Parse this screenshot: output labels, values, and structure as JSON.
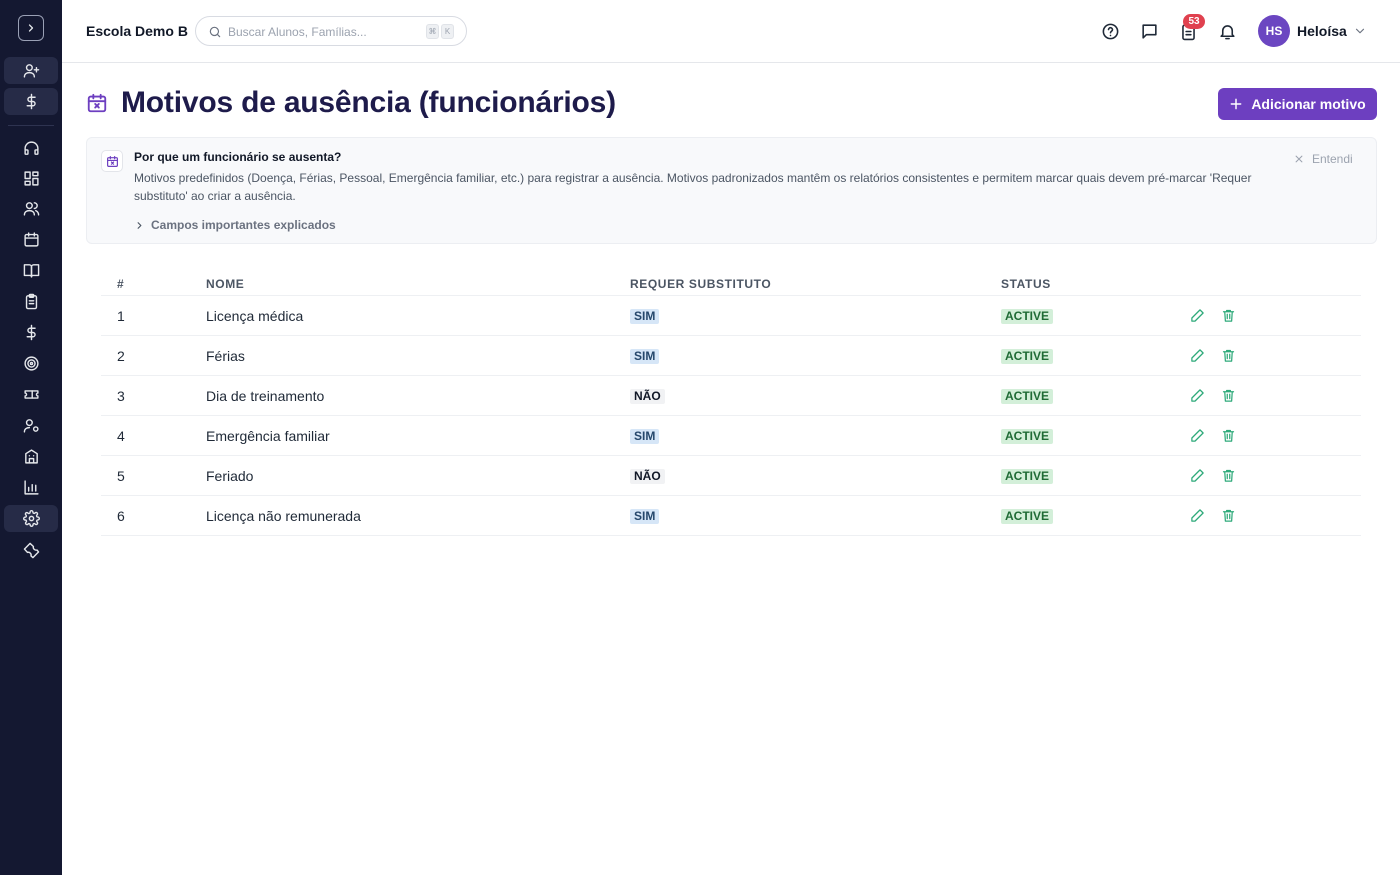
{
  "header": {
    "school_name": "Escola Demo B",
    "search_placeholder": "Buscar Alunos, Famílias...",
    "kbd_1": "⌘",
    "kbd_2": "K",
    "notifications_badge": "53",
    "user_initials": "HS",
    "user_name": "Heloísa"
  },
  "page": {
    "title": "Motivos de ausência (funcionários)",
    "add_button_label": "Adicionar motivo"
  },
  "info": {
    "title": "Por que um funcionário se ausenta?",
    "text": "Motivos predefinidos (Doença, Férias, Pessoal, Emergência familiar, etc.) para registrar a ausência. Motivos padronizados mantêm os relatórios consistentes e permitem marcar quais devem pré-marcar 'Requer substituto' ao criar a ausência.",
    "link": "Campos importantes explicados",
    "dismiss": "Entendi"
  },
  "table": {
    "headers": {
      "num": "#",
      "name": "NOME",
      "substitute": "REQUER SUBSTITUTO",
      "status": "STATUS"
    },
    "rows": [
      {
        "num": "1",
        "name": "Licença médica",
        "substitute": "SIM",
        "status": "ACTIVE"
      },
      {
        "num": "2",
        "name": "Férias",
        "substitute": "SIM",
        "status": "ACTIVE"
      },
      {
        "num": "3",
        "name": "Dia de treinamento",
        "substitute": "NÃO",
        "status": "ACTIVE"
      },
      {
        "num": "4",
        "name": "Emergência familiar",
        "substitute": "SIM",
        "status": "ACTIVE"
      },
      {
        "num": "5",
        "name": "Feriado",
        "substitute": "NÃO",
        "status": "ACTIVE"
      },
      {
        "num": "6",
        "name": "Licença não remunerada",
        "substitute": "SIM",
        "status": "ACTIVE"
      }
    ]
  },
  "colors": {
    "sidebar_bg": "#141831",
    "accent": "#6d3fc0",
    "title": "#1e1b4b",
    "action_icon": "#2eaa7a"
  }
}
